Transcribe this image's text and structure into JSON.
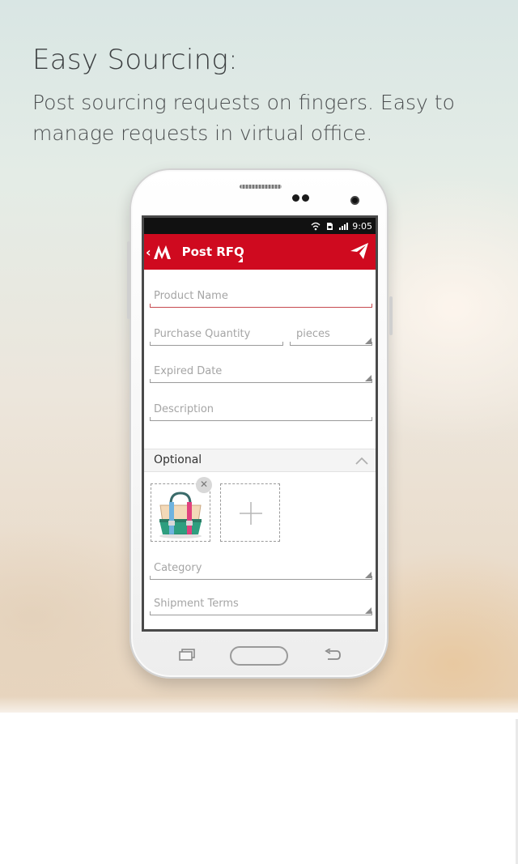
{
  "promo": {
    "headline": "Easy Sourcing:",
    "subline": "Post sourcing requests on fingers. Easy to manage requests in virtual office."
  },
  "status_bar": {
    "time": "9:05"
  },
  "app_bar": {
    "title": "Post RFQ"
  },
  "form": {
    "product_name": {
      "placeholder": "Product Name"
    },
    "purchase_quantity": {
      "placeholder": "Purchase Quantity"
    },
    "unit": {
      "value": "pieces"
    },
    "expired_date": {
      "placeholder": "Expired Date"
    },
    "description": {
      "placeholder": "Description"
    },
    "optional_section": {
      "label": "Optional"
    },
    "category": {
      "placeholder": "Category"
    },
    "shipment_terms": {
      "placeholder": "Shipment Terms"
    }
  },
  "colors": {
    "brand_red": "#cf0a1f",
    "active_underline": "#c64a4f"
  }
}
